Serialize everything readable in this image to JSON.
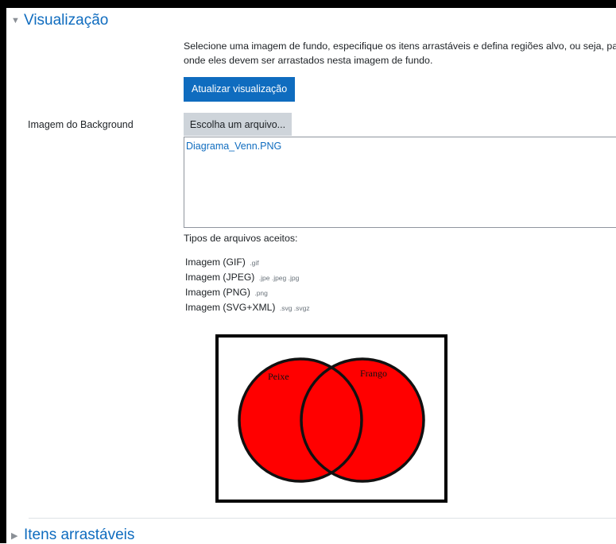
{
  "sections": {
    "visualizacao": {
      "title": "Visualização",
      "expanded": true
    },
    "itens": {
      "title": "Itens arrastáveis",
      "expanded": false
    }
  },
  "intro": {
    "line1": "Selecione uma imagem de fundo, especifique os itens arrastáveis e defina regiões alvo, ou seja, para",
    "line2": "onde eles devem ser arrastados nesta imagem de fundo."
  },
  "update_button": "Atualizar visualização",
  "background": {
    "label": "Imagem do Background",
    "choose_button": "Escolha um arquivo...",
    "selected_file": "Diagrama_Venn.PNG"
  },
  "file_types": {
    "title": "Tipos de arquivos aceitos:",
    "items": [
      {
        "name": "Imagem (GIF)",
        "ext": ".gif"
      },
      {
        "name": "Imagem (JPEG)",
        "ext": ".jpe .jpeg .jpg"
      },
      {
        "name": "Imagem (PNG)",
        "ext": ".png"
      },
      {
        "name": "Imagem (SVG+XML)",
        "ext": ".svg .svgz"
      }
    ]
  },
  "diagram": {
    "left_label": "Peixe",
    "right_label": "Frango",
    "fill_color": "#ff0000",
    "stroke_color": "#111111"
  },
  "colors": {
    "accent": "#0f6cbf",
    "secondary_button": "#ced4da"
  }
}
